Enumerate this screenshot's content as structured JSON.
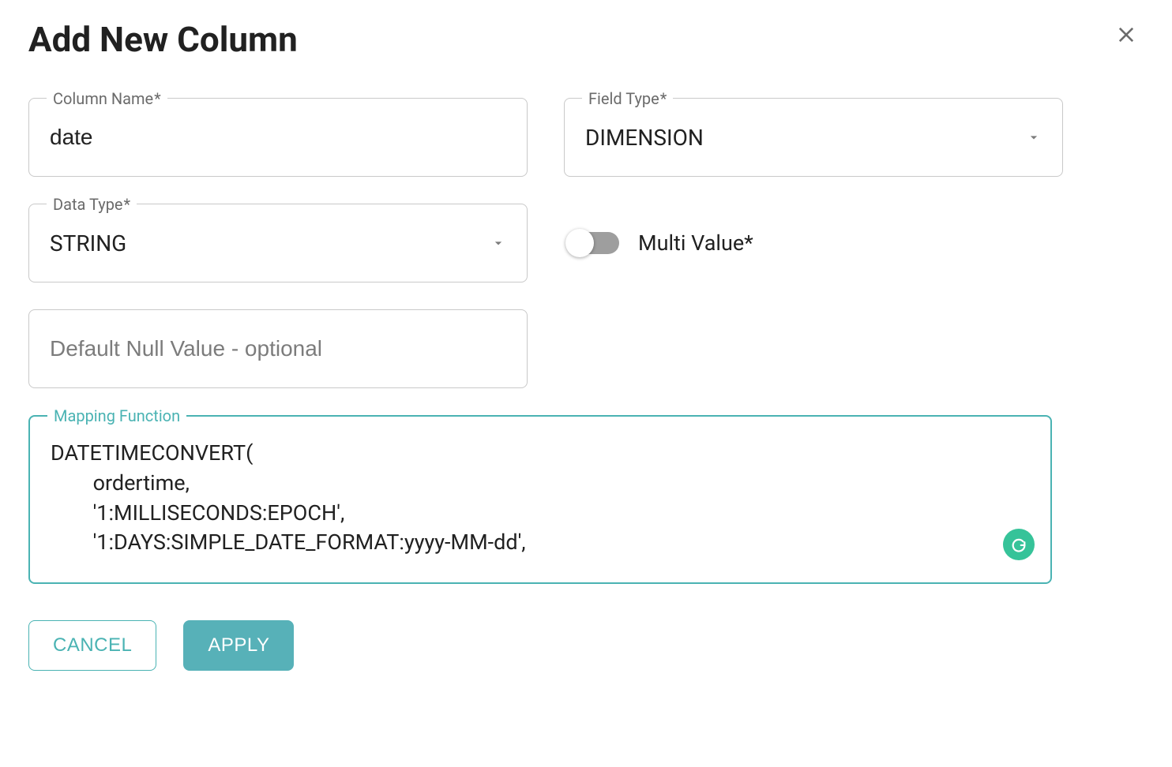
{
  "dialog": {
    "title": "Add New Column"
  },
  "fields": {
    "columnName": {
      "label": "Column Name",
      "required": "*",
      "value": "date"
    },
    "fieldType": {
      "label": "Field Type",
      "required": "*",
      "value": "DIMENSION"
    },
    "dataType": {
      "label": "Data Type",
      "required": "*",
      "value": "STRING"
    },
    "multiValue": {
      "label": "Multi Value*",
      "checked": false
    },
    "defaultNull": {
      "placeholder": "Default Null Value - optional",
      "value": ""
    },
    "mapping": {
      "label": "Mapping Function",
      "value": "DATETIMECONVERT(\n        ordertime,\n        '1:MILLISECONDS:EPOCH',\n        '1:DAYS:SIMPLE_DATE_FORMAT:yyyy-MM-dd', "
    }
  },
  "actions": {
    "cancel": "CANCEL",
    "apply": "APPLY"
  },
  "colors": {
    "accent": "#4ab3b3",
    "grammarly": "#36c399"
  }
}
